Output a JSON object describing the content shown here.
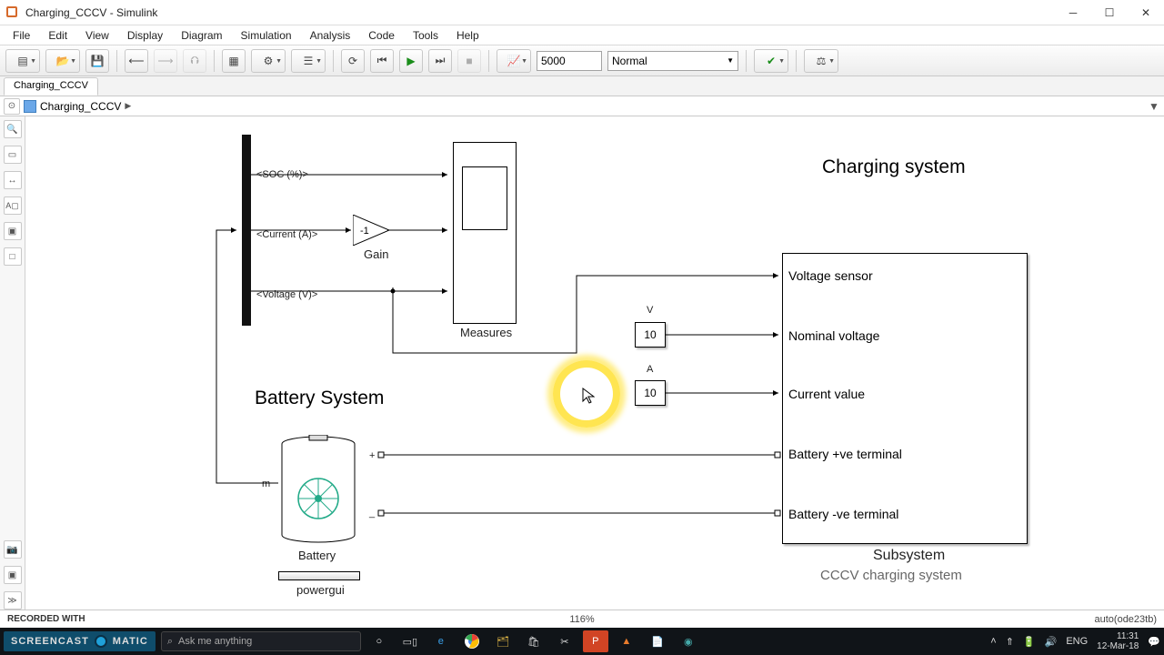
{
  "title": "Charging_CCCV - Simulink",
  "menus": [
    "File",
    "Edit",
    "View",
    "Display",
    "Diagram",
    "Simulation",
    "Analysis",
    "Code",
    "Tools",
    "Help"
  ],
  "toolbar": {
    "stop_time": "5000",
    "mode": "Normal"
  },
  "tab": "Charging_CCCV",
  "breadcrumb": "Charging_CCCV",
  "signals": {
    "soc": "<SOC (%)>",
    "current": "<Current (A)>",
    "voltage": "<Voltage (V)>"
  },
  "gain": {
    "label": "Gain",
    "k": "-1"
  },
  "scope": {
    "label": "Measures"
  },
  "battery_section": "Battery System",
  "battery": {
    "label": "Battery",
    "m": "m",
    "plus": "+",
    "minus": "_"
  },
  "powergui": "powergui",
  "const_v": {
    "label": "V",
    "value": "10"
  },
  "const_a": {
    "label": "A",
    "value": "10"
  },
  "charging_title": "Charging system",
  "subsystem": {
    "ports": {
      "vsense": "Voltage sensor",
      "vnom": "Nominal voltage",
      "ival": "Current value",
      "bplus": "Battery +ve terminal",
      "bminus": "Battery -ve terminal"
    },
    "name": "Subsystem",
    "sub": "CCCV charging system"
  },
  "status": {
    "zoom": "116%",
    "solver": "auto(ode23tb)"
  },
  "recorded": "RECORDED WITH",
  "scm": "SCREENCAST   MATIC",
  "search_placeholder": "Ask me anything",
  "tray": {
    "lang": "ENG",
    "time": "11:31",
    "date": "12-Mar-18"
  }
}
